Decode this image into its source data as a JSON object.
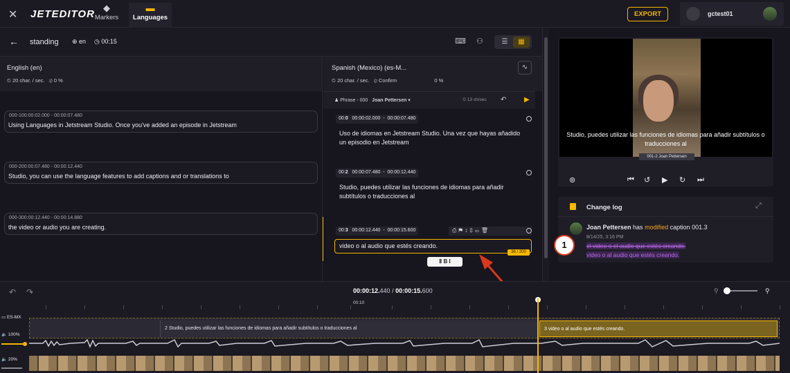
{
  "topbar": {
    "logo": "JETEDITOR",
    "tabs": [
      {
        "label": "Markers"
      },
      {
        "label": "Languages"
      }
    ],
    "export_label": "EXPORT",
    "username": "gctest01"
  },
  "episode": {
    "title": "standing",
    "lang": "en",
    "duration": "00:15"
  },
  "source": {
    "language": "English (en)",
    "speed": "20 char. / sec.",
    "progress": "0 %",
    "captions": [
      {
        "index": "000-1",
        "start": "00:00:02.000",
        "end": "00:00:07.480",
        "text": "Using Languages in Jetstream Studio. Once you've added an episode in Jetstream"
      },
      {
        "index": "000-2",
        "start": "00:00:07.480",
        "end": "00:00:12.440",
        "text": "Studio, you can use the language features to add captions and or translations to"
      },
      {
        "index": "000-3",
        "start": "00:00:12.440",
        "end": "00:00:14.880",
        "text": "the video or audio you are creating."
      }
    ]
  },
  "target": {
    "language": "Spanish (Mexico) (es-M...",
    "speed": "20 char. / sec.",
    "confirm_label": "Confirm",
    "progress": "0 %",
    "phrase_label": "Phrase - 000",
    "speaker": "Joan Pettersen",
    "rate": "13 ch/sec",
    "captions": [
      {
        "index": "0",
        "start": "00:00:02.000",
        "end": "00:00:07.480",
        "text": "Uso de idiomas en Jetstream Studio. Una vez que hayas añadido un episodio en Jetstream"
      },
      {
        "index": "2",
        "start": "00:00:07.480",
        "end": "00:00:12.440",
        "text": "Studio, puedes utilizar las funciones de idiomas para añadir subtítulos o traducciones al"
      },
      {
        "index": "3",
        "start": "00:00:12.440",
        "end": "00:00:15.600",
        "text": "video o al audio que estés creando.",
        "counter": "36 / 200"
      }
    ],
    "format_bar": "Ⅱ  B  I"
  },
  "video": {
    "subtitle": "Studio, puedes utilizar las funciones de idiomas para añadir subtítulos o traducciones al",
    "tag": "001-2  Joan Pettersen"
  },
  "changelog": {
    "title": "Change log",
    "author": "Joan Pettersen",
    "action_pre": "has",
    "action": "modified",
    "action_post": "caption 001.3",
    "date": "8/14/25, 3:16 PM",
    "old_text": "el video o el audio que estés creando.",
    "new_text": "video o al audio que estés creando."
  },
  "annotation": {
    "step": "1"
  },
  "timeline": {
    "current": "00:00:12.",
    "current_ms": "440",
    "total": "00:00:15.",
    "total_ms": "600",
    "ruler_label": "00:10",
    "track_lang": "ES-MX",
    "track_vol": "100%",
    "audio_vol": "20%",
    "seg2": "2  Studio, puedes utilizar las funciones de idiomas para añadir subtítulos o traducciones al",
    "seg3": "3  video o al audio que estés creando."
  },
  "colors": {
    "accent": "#f5b700",
    "annotation_red": "#d9381e",
    "diff_purple": "#b86ae0"
  }
}
